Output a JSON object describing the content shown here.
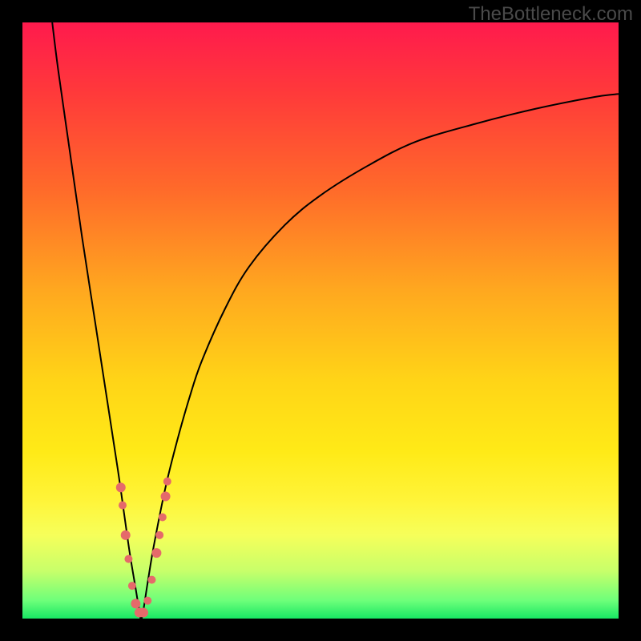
{
  "watermark": "TheBottleneck.com",
  "colors": {
    "page_bg": "#000000",
    "curve_stroke": "#000000",
    "marker_fill": "#e56a6a",
    "marker_stroke": "#d94f4f"
  },
  "chart_data": {
    "type": "line",
    "title": "",
    "xlabel": "",
    "ylabel": "",
    "xlim": [
      0,
      100
    ],
    "ylim": [
      0,
      100
    ],
    "grid": false,
    "series": [
      {
        "name": "bottleneck-curve",
        "x": [
          5,
          6,
          8,
          10,
          12,
          14,
          16,
          17,
          18,
          19,
          19.5,
          20,
          21,
          22,
          24,
          26,
          28,
          30,
          34,
          38,
          44,
          50,
          58,
          66,
          76,
          86,
          96,
          100
        ],
        "values": [
          100,
          92,
          78,
          64,
          51,
          38,
          25,
          18,
          11,
          5,
          2,
          0,
          6,
          12,
          22,
          30,
          37,
          43,
          52,
          59,
          66,
          71,
          76,
          80,
          83,
          85.5,
          87.5,
          88
        ]
      }
    ],
    "markers": [
      {
        "x": 16.5,
        "y": 22,
        "r": 6
      },
      {
        "x": 16.8,
        "y": 19,
        "r": 5
      },
      {
        "x": 17.3,
        "y": 14,
        "r": 6
      },
      {
        "x": 17.8,
        "y": 10,
        "r": 5
      },
      {
        "x": 18.4,
        "y": 5.5,
        "r": 5
      },
      {
        "x": 19.0,
        "y": 2.5,
        "r": 6
      },
      {
        "x": 19.6,
        "y": 1.0,
        "r": 6
      },
      {
        "x": 20.3,
        "y": 1.0,
        "r": 6
      },
      {
        "x": 21.0,
        "y": 3.0,
        "r": 5
      },
      {
        "x": 21.7,
        "y": 6.5,
        "r": 5
      },
      {
        "x": 22.5,
        "y": 11,
        "r": 6
      },
      {
        "x": 23.0,
        "y": 14,
        "r": 5
      },
      {
        "x": 23.5,
        "y": 17,
        "r": 5
      },
      {
        "x": 24.0,
        "y": 20.5,
        "r": 6
      },
      {
        "x": 24.3,
        "y": 23,
        "r": 5
      }
    ]
  }
}
